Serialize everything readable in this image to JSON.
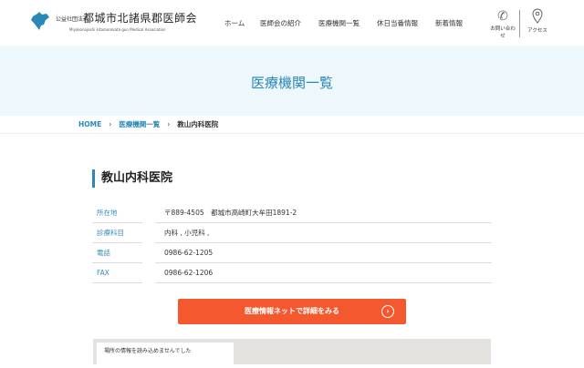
{
  "header": {
    "org_type": "公益社団法人",
    "org_name": "都城市北諸県郡医師会",
    "org_name_en": "Miyakonojoshi kitamorokata gun Medical Association",
    "nav": [
      "ホーム",
      "医師会の紹介",
      "医療機関一覧",
      "休日当番情報",
      "新着情報"
    ],
    "contact_label": "お問い合わせ",
    "access_label": "アクセス"
  },
  "hero": {
    "title": "医療機関一覧"
  },
  "breadcrumb": [
    "HOME",
    "医療機関一覧",
    "教山内科医院"
  ],
  "clinic": {
    "name": "教山内科医院",
    "rows": [
      {
        "label": "所在地",
        "value": "〒889-4505　都城市高崎町大牟田1891-2"
      },
      {
        "label": "診療科目",
        "value": "内科 , 小児科 ,"
      },
      {
        "label": "電話",
        "value": "0986-62-1205"
      },
      {
        "label": "FAX",
        "value": "0986-62-1206"
      }
    ]
  },
  "cta": {
    "label": "医療情報ネットで詳細をみる"
  },
  "map": {
    "error": "場所の情報を読み込めませんでした"
  },
  "colors": {
    "accent": "#2a88b6",
    "cta": "#f4582e",
    "hero_bg": "#eef7fb"
  }
}
